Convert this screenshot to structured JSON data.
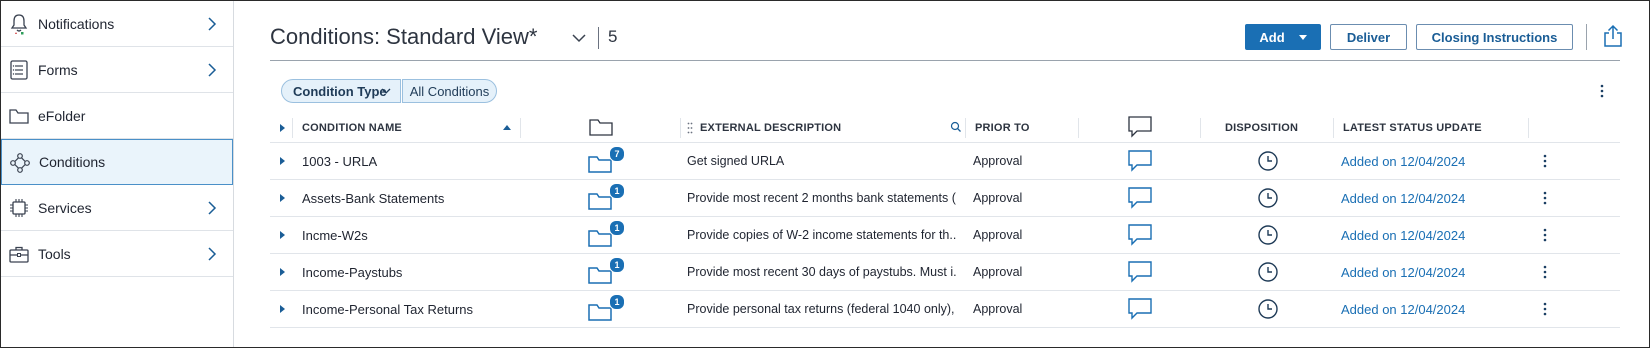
{
  "sidebar": {
    "items": [
      {
        "label": "Notifications",
        "icon": "bell-icon",
        "has_chevron": true
      },
      {
        "label": "Forms",
        "icon": "form-icon",
        "has_chevron": true
      },
      {
        "label": "eFolder",
        "icon": "folder-icon",
        "has_chevron": false
      },
      {
        "label": "Conditions",
        "icon": "conditions-icon",
        "has_chevron": false,
        "active": true
      },
      {
        "label": "Services",
        "icon": "chip-icon",
        "has_chevron": true
      },
      {
        "label": "Tools",
        "icon": "toolbox-icon",
        "has_chevron": true
      }
    ]
  },
  "header": {
    "title": "Conditions: Standard View*",
    "count": "5",
    "add_label": "Add",
    "deliver_label": "Deliver",
    "closing_label": "Closing Instructions"
  },
  "filter": {
    "type_label": "Condition Type",
    "value_label": "All Conditions"
  },
  "table": {
    "columns": {
      "name": "CONDITION NAME",
      "desc": "EXTERNAL DESCRIPTION",
      "prior": "PRIOR TO",
      "disp": "DISPOSITION",
      "status": "LATEST STATUS UPDATE"
    },
    "rows": [
      {
        "name": "1003 - URLA",
        "docs": "7",
        "desc": "Get signed URLA",
        "prior": "Approval",
        "status": "Added on 12/04/2024"
      },
      {
        "name": "Assets-Bank Statements",
        "docs": "1",
        "desc": "Provide most recent 2 months bank statements (...",
        "prior": "Approval",
        "status": "Added on 12/04/2024"
      },
      {
        "name": "Incme-W2s",
        "docs": "1",
        "desc": "Provide copies of W-2 income statements for th...",
        "prior": "Approval",
        "status": "Added on 12/04/2024"
      },
      {
        "name": "Income-Paystubs",
        "docs": "1",
        "desc": "Provide most recent 30 days of paystubs. Must i...",
        "prior": "Approval",
        "status": "Added on 12/04/2024"
      },
      {
        "name": "Income-Personal Tax Returns",
        "docs": "1",
        "desc": "Provide personal tax returns (federal 1040 only), ...",
        "prior": "Approval",
        "status": "Added on 12/04/2024"
      }
    ]
  },
  "colors": {
    "accent": "#1a6fb4",
    "active_bg": "#eaf4fb",
    "chip_bg": "#e5f1fa"
  }
}
